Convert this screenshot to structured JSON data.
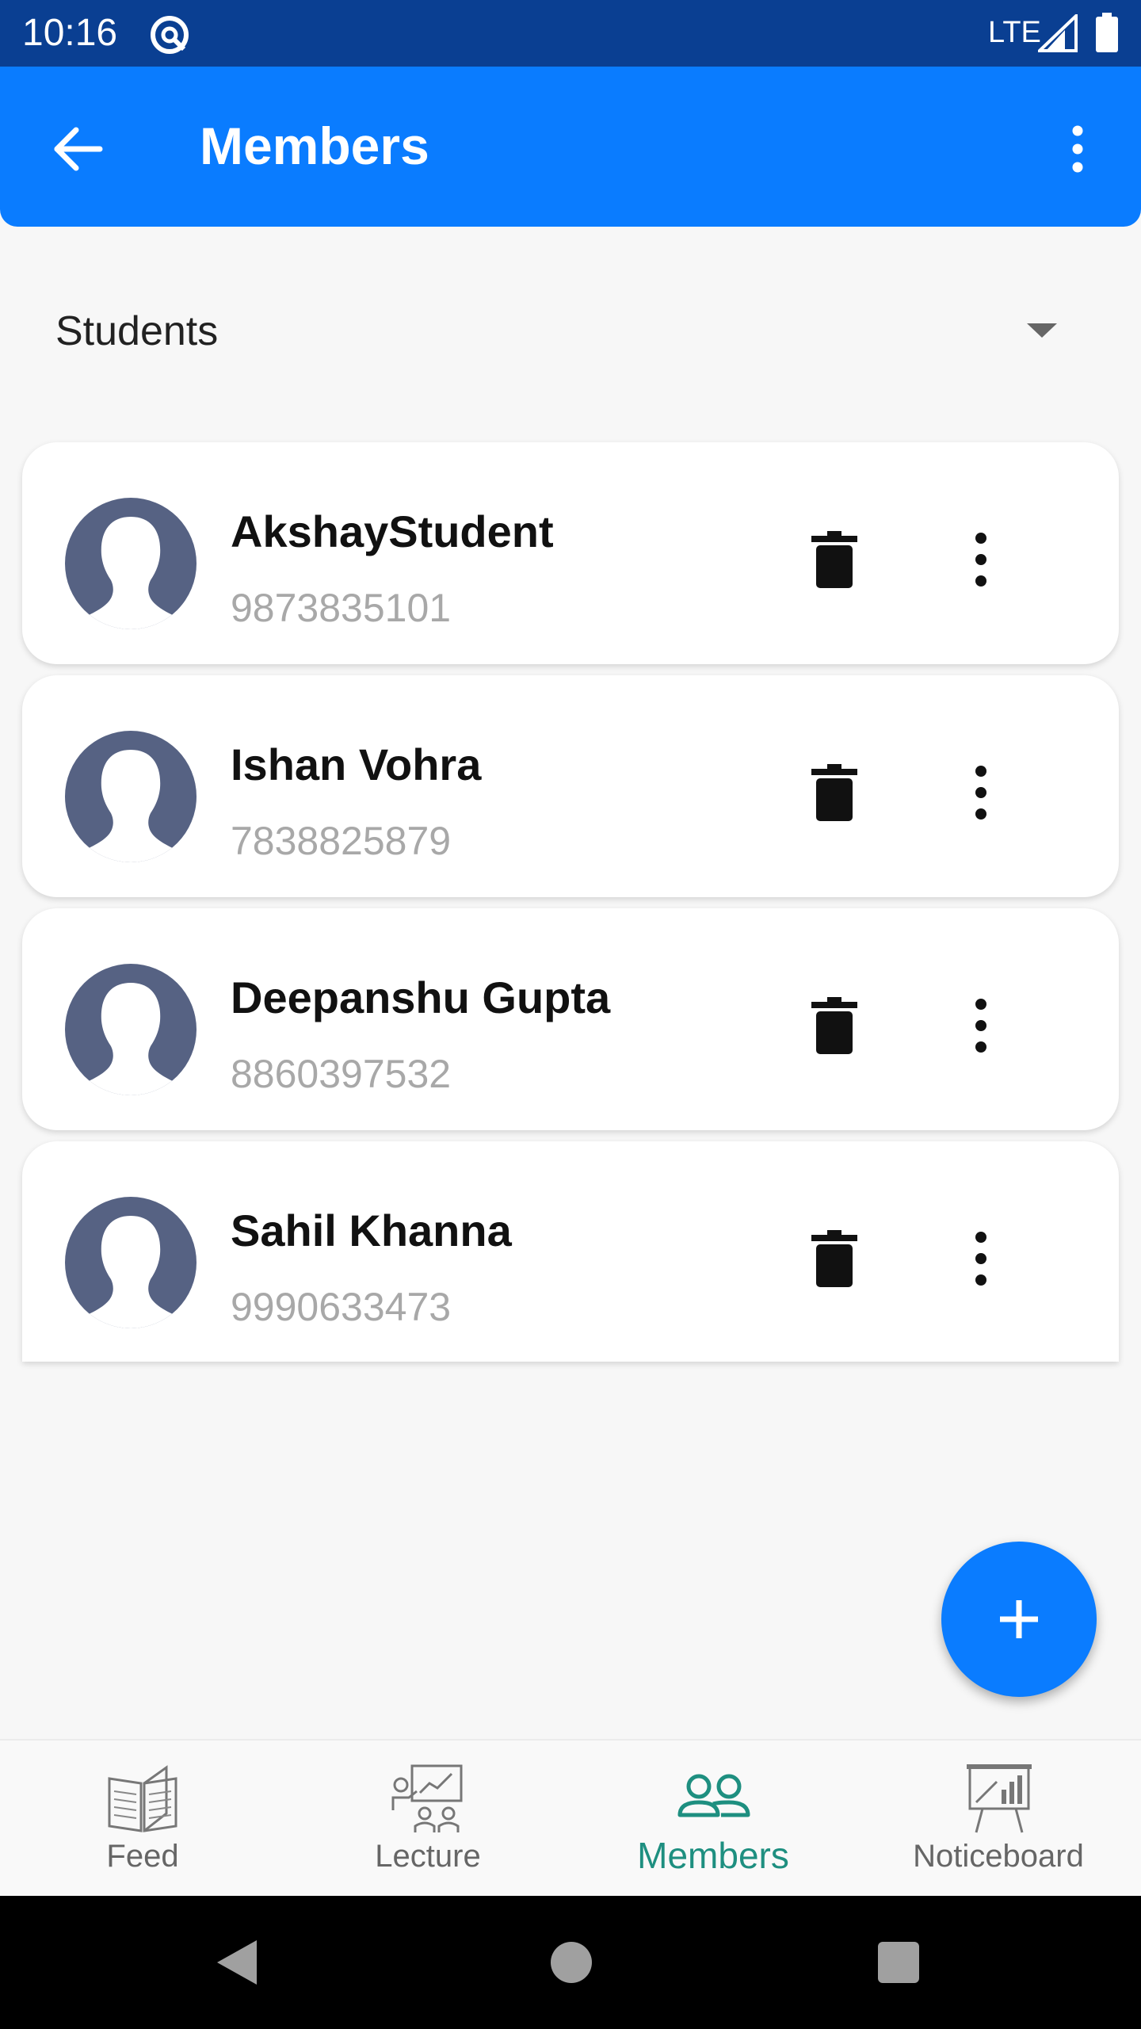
{
  "status_bar": {
    "time": "10:16",
    "network": "LTE"
  },
  "app_bar": {
    "title": "Members",
    "accent_color": "#0a7cff"
  },
  "filter": {
    "selected": "Students"
  },
  "members": [
    {
      "name": "AkshayStudent",
      "phone": "9873835101"
    },
    {
      "name": "Ishan Vohra",
      "phone": "7838825879"
    },
    {
      "name": "Deepanshu Gupta",
      "phone": "8860397532"
    },
    {
      "name": "Sahil Khanna",
      "phone": "9990633473"
    }
  ],
  "fab": {
    "icon": "plus-icon"
  },
  "bottom_nav": {
    "items": [
      {
        "label": "Feed",
        "icon": "book-icon"
      },
      {
        "label": "Lecture",
        "icon": "lecture-icon"
      },
      {
        "label": "Members",
        "icon": "members-icon",
        "active": true
      },
      {
        "label": "Noticeboard",
        "icon": "noticeboard-icon"
      }
    ],
    "active_color": "#1e8f80"
  },
  "system_nav": {
    "icons": [
      "back-triangle-icon",
      "home-circle-icon",
      "recents-square-icon"
    ]
  }
}
